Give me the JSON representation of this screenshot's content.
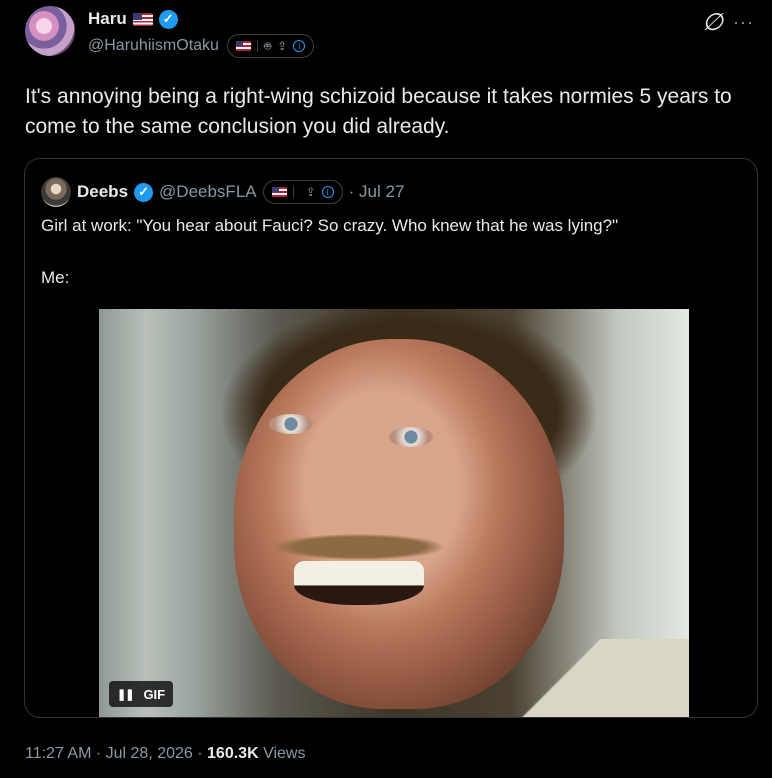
{
  "author": {
    "name": "Haru",
    "handle": "@HaruhiismOtaku"
  },
  "tweet": {
    "text": "It's annoying being a right-wing schizoid because it takes normies 5 years to come to the same conclusion you did already."
  },
  "quoted": {
    "name": "Deebs",
    "handle": "@DeebsFLA",
    "date": "· Jul 27",
    "text": "Girl at work: \"You hear about Fauci? So crazy. Who knew that he was lying?\"\n\nMe:",
    "media_badge": "GIF"
  },
  "footer": {
    "time": "11:27 AM · Jul 28, 2026 · ",
    "views_count": "160.3K",
    "views_label": " Views"
  },
  "icons": {
    "verified": "verified-check-icon",
    "flag": "us-flag-icon",
    "android": "android-icon",
    "apple": "apple-icon",
    "share": "share-icon",
    "info": "info-icon",
    "grok": "grok-icon",
    "more": "more-icon",
    "pause": "pause-icon"
  },
  "colors": {
    "background": "#000000",
    "text": "#e7e9ea",
    "muted": "#8b98a5",
    "verified": "#1d9bf0",
    "border": "#2f3336"
  }
}
